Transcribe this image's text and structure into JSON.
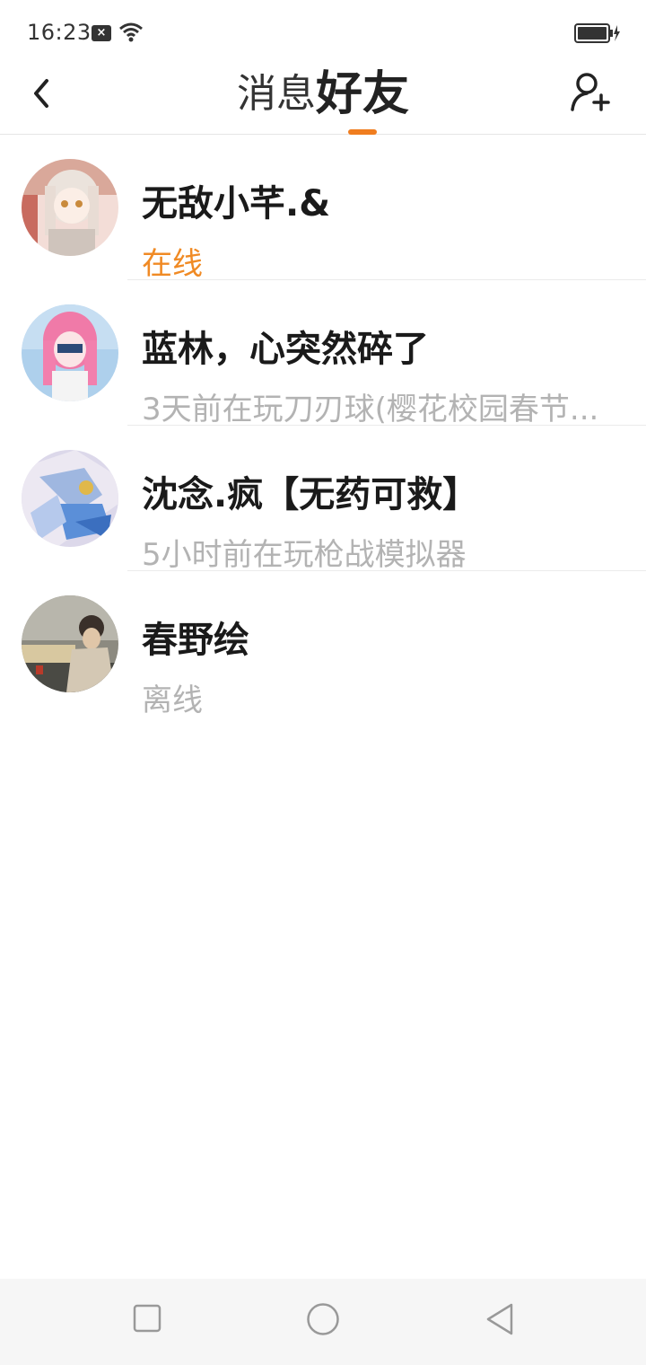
{
  "status_bar": {
    "time": "16:23",
    "sim_icon": "sim-off-icon",
    "wifi_icon": "wifi-icon",
    "battery_icon": "battery-charging-icon"
  },
  "nav": {
    "tabs": [
      {
        "label": "消息",
        "active": false
      },
      {
        "label": "好友",
        "active": true
      }
    ],
    "accent_color": "#f07d1f"
  },
  "friends": [
    {
      "name": "无敌小芊.&",
      "status": "在线",
      "online": true
    },
    {
      "name": "蓝林，心突然碎了",
      "status": "3天前在玩刀刃球(樱花校园春节...",
      "online": false
    },
    {
      "name": "沈念.疯【无药可救】",
      "status": "5小时前在玩枪战模拟器",
      "online": false
    },
    {
      "name": "春野绘",
      "status": "离线",
      "online": false
    }
  ],
  "colors": {
    "online": "#f08a24",
    "secondary_text": "#b3b3b3"
  }
}
